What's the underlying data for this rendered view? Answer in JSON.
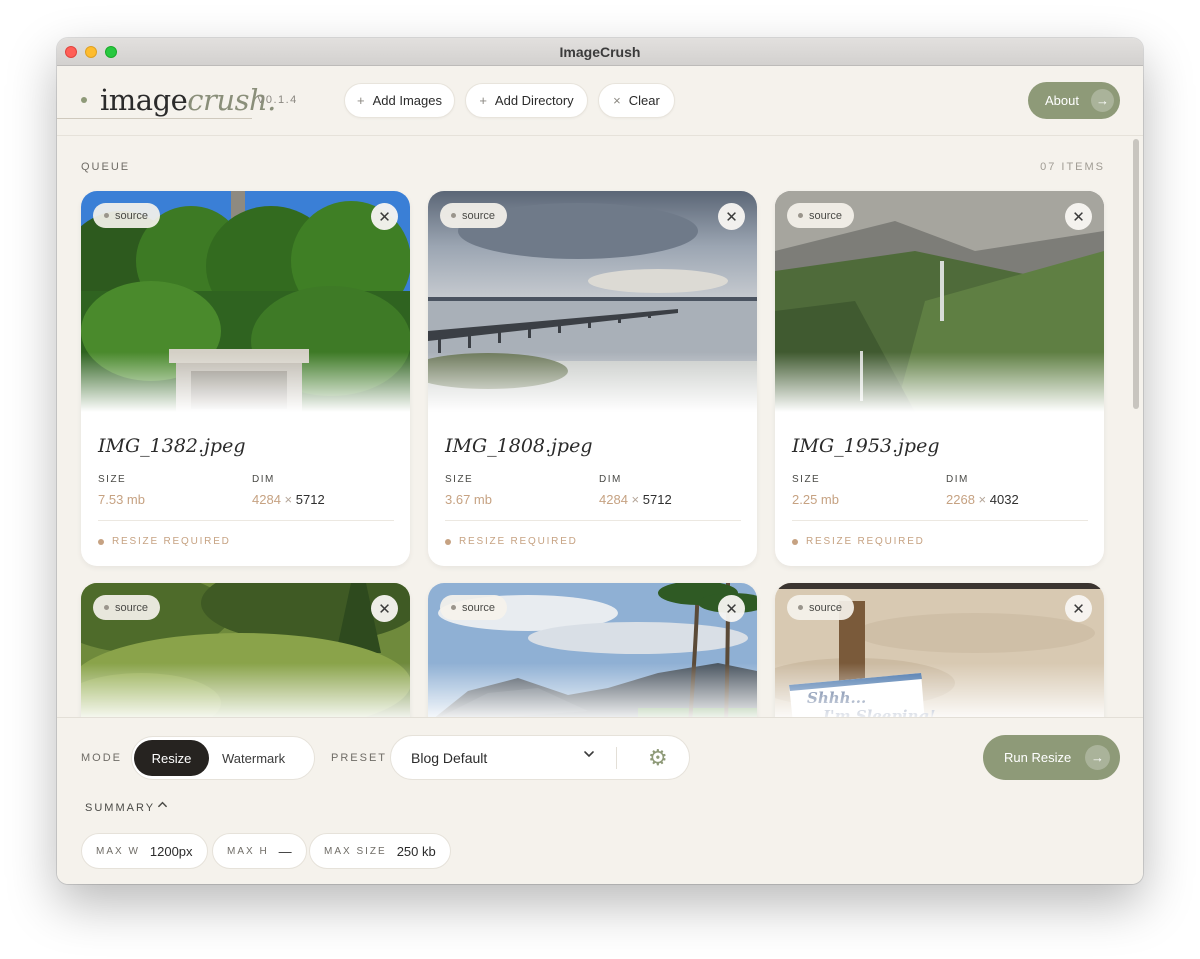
{
  "window": {
    "title": "ImageCrush"
  },
  "header": {
    "logo_main": "image",
    "logo_accent": "crush.",
    "version": "V0.1.4",
    "buttons": [
      {
        "prefix": "+",
        "label": "Add Images"
      },
      {
        "prefix": "+",
        "label": "Add Directory"
      },
      {
        "prefix": "×",
        "label": "Clear"
      }
    ],
    "about_label": "About"
  },
  "queue": {
    "label": "QUEUE",
    "count": "07 ITEMS",
    "items": [
      {
        "badge": "source",
        "filename": "IMG_1382.jpeg",
        "size_label": "SIZE",
        "size": "7.53 mb",
        "dim_label": "DIM",
        "dim_w": "4284",
        "dim_sep": "×",
        "dim_h": "5712",
        "status": "RESIZE REQUIRED"
      },
      {
        "badge": "source",
        "filename": "IMG_1808.jpeg",
        "size_label": "SIZE",
        "size": "3.67 mb",
        "dim_label": "DIM",
        "dim_w": "4284",
        "dim_sep": "×",
        "dim_h": "5712",
        "status": "RESIZE REQUIRED"
      },
      {
        "badge": "source",
        "filename": "IMG_1953.jpeg",
        "size_label": "SIZE",
        "size": "2.25 mb",
        "dim_label": "DIM",
        "dim_w": "2268",
        "dim_sep": "×",
        "dim_h": "4032",
        "status": "RESIZE REQUIRED"
      },
      {
        "badge": "source"
      },
      {
        "badge": "source"
      },
      {
        "badge": "source",
        "sign_text": "Shhh...",
        "sign_text2": "I'm Sleeping!"
      }
    ]
  },
  "footer": {
    "mode_label": "MODE",
    "mode_options": [
      "Resize",
      "Watermark"
    ],
    "mode_selected": "Resize",
    "preset_label": "PRESET",
    "preset_value": "Blog Default",
    "run_label": "Run Resize",
    "summary_label": "SUMMARY",
    "chips": [
      {
        "key": "MAX W",
        "value": "1200px"
      },
      {
        "key": "MAX H",
        "value": "—"
      },
      {
        "key": "MAX SIZE",
        "value": "250 kb"
      }
    ]
  },
  "icons": {
    "close": "close-icon",
    "chevron": "chevron-down-icon",
    "gear": "gear-icon",
    "arrow": "arrow-right-icon",
    "caret": "chevron-up-icon"
  }
}
